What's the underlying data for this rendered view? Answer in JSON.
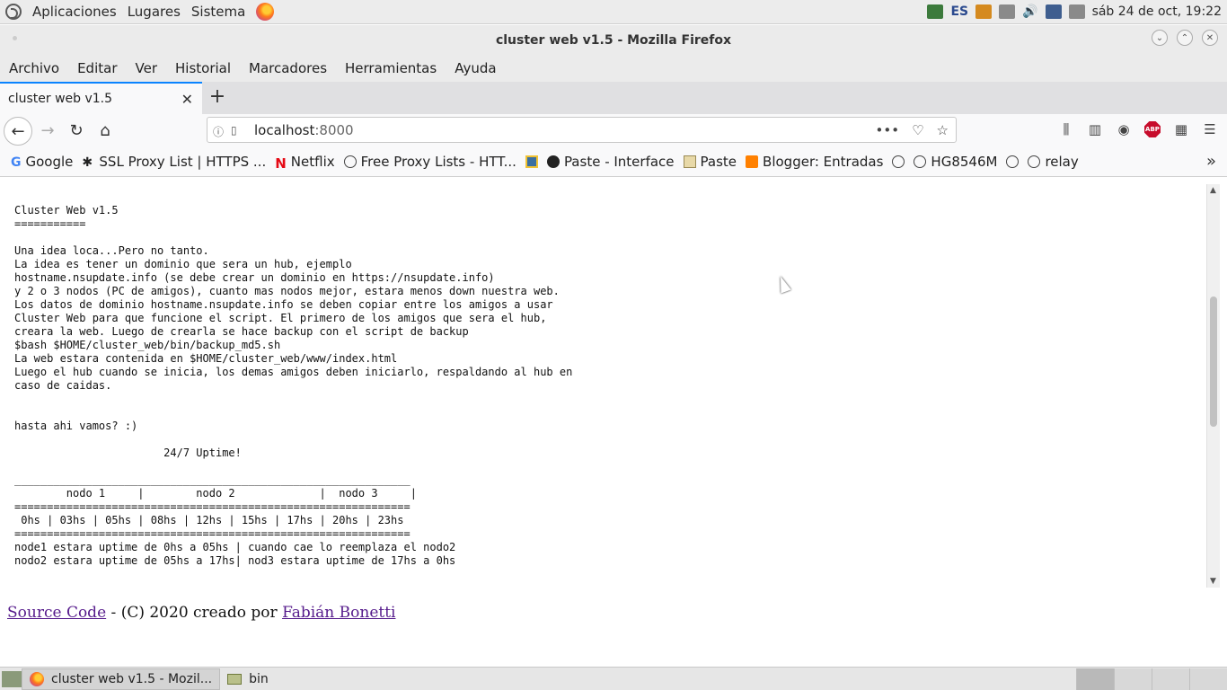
{
  "panel": {
    "menus": [
      "Aplicaciones",
      "Lugares",
      "Sistema"
    ],
    "keyboard_layout": "ES",
    "datetime": "sáb 24 de oct, 19:22"
  },
  "window": {
    "title": "cluster web v1.5 - Mozilla Firefox"
  },
  "menubar": [
    "Archivo",
    "Editar",
    "Ver",
    "Historial",
    "Marcadores",
    "Herramientas",
    "Ayuda"
  ],
  "tab": {
    "label": "cluster web v1.5"
  },
  "urlbar": {
    "host": "localhost",
    "port": ":8000"
  },
  "bookmarks": [
    {
      "label": "Google",
      "icon": "google-icon"
    },
    {
      "label": "SSL Proxy List | HTTPS ...",
      "icon": "proxy-icon"
    },
    {
      "label": "Netflix",
      "icon": "netflix-icon"
    },
    {
      "label": "Free Proxy Lists - HTT...",
      "icon": "globe-icon"
    },
    {
      "label": "",
      "icon": "python-icon"
    },
    {
      "label": "Paste - Interface",
      "icon": "paste-icon"
    },
    {
      "label": "Paste",
      "icon": "clipboard-icon"
    },
    {
      "label": "Blogger: Entradas",
      "icon": "blogger-icon"
    },
    {
      "label": "",
      "icon": "globe-icon"
    },
    {
      "label": "HG8546M",
      "icon": "globe-icon"
    },
    {
      "label": "",
      "icon": "globe-icon"
    },
    {
      "label": "relay",
      "icon": "globe-icon"
    }
  ],
  "content": {
    "readme": "Cluster Web v1.5\n===========\n\nUna idea loca...Pero no tanto.\nLa idea es tener un dominio que sera un hub, ejemplo\nhostname.nsupdate.info (se debe crear un dominio en https://nsupdate.info)\ny 2 o 3 nodos (PC de amigos), cuanto mas nodos mejor, estara menos down nuestra web.\nLos datos de dominio hostname.nsupdate.info se deben copiar entre los amigos a usar\nCluster Web para que funcione el script. El primero de los amigos que sera el hub,\ncreara la web. Luego de crearla se hace backup con el script de backup\n$bash $HOME/cluster_web/bin/backup_md5.sh\nLa web estara contenida en $HOME/cluster_web/www/index.html\nLuego el hub cuando se inicia, los demas amigos deben iniciarlo, respaldando al hub en\ncaso de caidas.\n\n\nhasta ahi vamos? :)\n\n                       24/7 Uptime!\n\n_____________________________________________________________\n        nodo 1     |        nodo 2             |  nodo 3     |\n=============================================================\n 0hs | 03hs | 05hs | 08hs | 12hs | 15hs | 17hs | 20hs | 23hs\n=============================================================\nnode1 estara uptime de 0hs a 05hs | cuando cae lo reemplaza el nodo2\nnodo2 estara uptime de 05hs a 17hs| nod3 estara uptime de 17hs a 0hs\n\n\ncon esto logramos nuestro servidor web entre amigos , sin pagar hosting"
  },
  "footer": {
    "source_link": "Source Code",
    "middle_text": " - (C) 2020 creado por ",
    "author_link": "Fabián Bonetti"
  },
  "taskbar": {
    "items": [
      "cluster web v1.5 - Mozil...",
      "bin"
    ]
  }
}
